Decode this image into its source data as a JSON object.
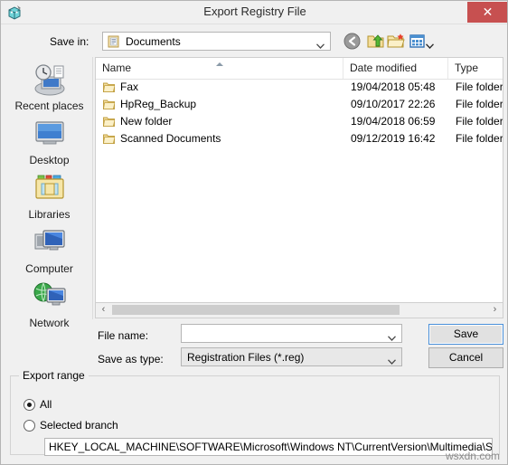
{
  "window": {
    "title": "Export Registry File",
    "icon": "registry-editor-icon",
    "close_label": "✕",
    "close_color": "#c75050"
  },
  "toolbar": {
    "save_in_label": "Save in:",
    "current_folder": "Documents",
    "buttons": [
      {
        "name": "back-button",
        "icon": "back-arrow-icon"
      },
      {
        "name": "up-one-level-button",
        "icon": "up-folder-icon"
      },
      {
        "name": "new-folder-button",
        "icon": "new-folder-icon"
      },
      {
        "name": "views-button",
        "icon": "views-icon"
      }
    ]
  },
  "places": [
    {
      "label": "Recent places",
      "icon": "recent-places-icon"
    },
    {
      "label": "Desktop",
      "icon": "desktop-icon"
    },
    {
      "label": "Libraries",
      "icon": "libraries-icon"
    },
    {
      "label": "Computer",
      "icon": "computer-icon"
    },
    {
      "label": "Network",
      "icon": "network-icon"
    }
  ],
  "file_list": {
    "columns": [
      "Name",
      "Date modified",
      "Type"
    ],
    "sort_column": "Name",
    "sort_direction": "ascending",
    "rows": [
      {
        "name": "Fax",
        "date": "19/04/2018 05:48",
        "type": "File folder",
        "icon": "folder-icon"
      },
      {
        "name": "HpReg_Backup",
        "date": "09/10/2017 22:26",
        "type": "File folder",
        "icon": "folder-icon"
      },
      {
        "name": "New folder",
        "date": "19/04/2018 06:59",
        "type": "File folder",
        "icon": "folder-icon"
      },
      {
        "name": "Scanned Documents",
        "date": "09/12/2019 16:42",
        "type": "File folder",
        "icon": "folder-icon"
      }
    ]
  },
  "scrollbar": {
    "left_arrow": "‹",
    "right_arrow": "›"
  },
  "form": {
    "file_name_label": "File name:",
    "file_name_value": "",
    "file_name_placeholder": "",
    "save_as_type_label": "Save as type:",
    "save_as_type_value": "Registration Files (*.reg)",
    "save_button": "Save",
    "cancel_button": "Cancel"
  },
  "export_range": {
    "title": "Export range",
    "options": [
      {
        "label": "All",
        "selected": true
      },
      {
        "label": "Selected branch",
        "selected": false
      }
    ],
    "branch_value": "HKEY_LOCAL_MACHINE\\SOFTWARE\\Microsoft\\Windows NT\\CurrentVersion\\Multimedia\\SystemProfile"
  },
  "watermark": "wsxdn.com"
}
